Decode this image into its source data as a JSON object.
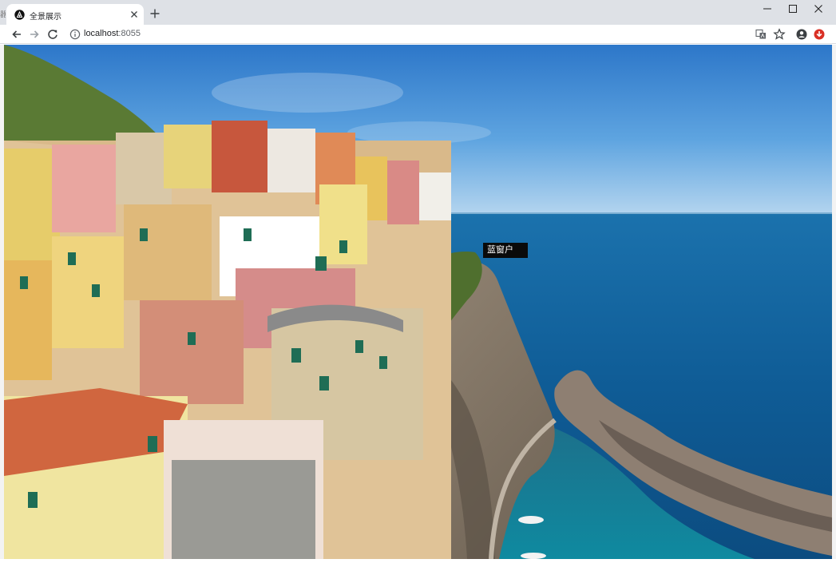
{
  "browser": {
    "tab": {
      "title": "全景展示",
      "favicon": "threejs-logo-icon"
    },
    "address_bar": {
      "host": "localhost",
      "port": ":8055"
    },
    "nav": {
      "back": "back-arrow-icon",
      "forward": "forward-arrow-icon",
      "reload": "reload-icon"
    },
    "toolbar_icons": [
      "translate-icon",
      "star-icon",
      "profile-icon",
      "extension-icon"
    ],
    "window_controls": [
      "minimize-icon",
      "maximize-icon",
      "close-icon"
    ],
    "left_edge_glyph": "器"
  },
  "panorama": {
    "hotspot_label": "蓝窗户",
    "colors": {
      "sky": "#4f97d9",
      "sea": "#0f5c96",
      "cliff": "#8f8070",
      "label_bg": "#0a0a0a"
    }
  }
}
